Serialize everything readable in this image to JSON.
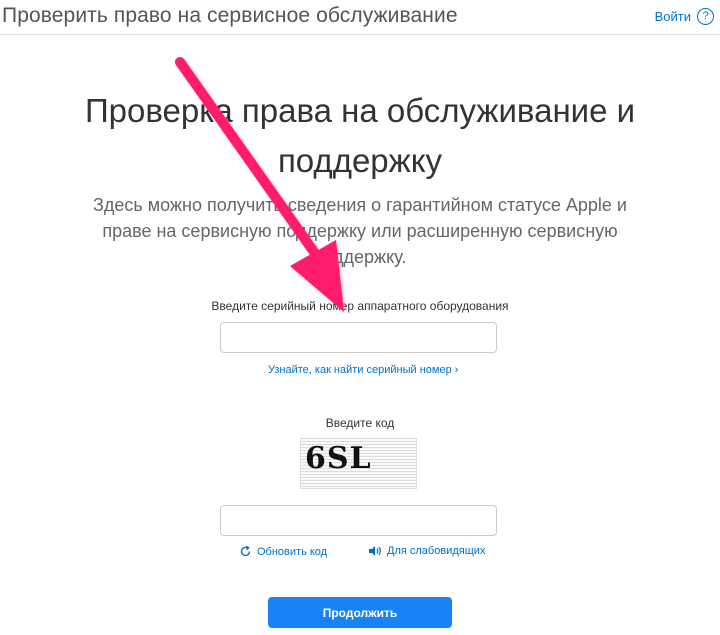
{
  "header": {
    "title": "Проверить право на сервисное обслуживание",
    "login_label": "Войти",
    "help_icon": "?"
  },
  "main": {
    "headline": "Проверка права на обслуживание и поддержку",
    "intro": "Здесь можно получить сведения о гарантийном статусе Apple и праве на сервисную поддержку или расширенную сервисную поддержку."
  },
  "serial": {
    "label": "Введите серийный номер аппаратного оборудования",
    "value": "",
    "help_link": "Узнайте, как найти серийный номер ›"
  },
  "code": {
    "label": "Введите код",
    "captcha_text": "6SL",
    "value": "",
    "refresh_label": "Обновить код",
    "audio_label": "Для слабовидящих"
  },
  "submit": {
    "label": "Продолжить"
  },
  "colors": {
    "accent": "#0070c9",
    "button": "#1a82f7",
    "annotation_arrow": "#ff1f6e"
  },
  "icons": [
    "help-icon",
    "refresh-icon",
    "speaker-icon",
    "annotation-arrow"
  ]
}
